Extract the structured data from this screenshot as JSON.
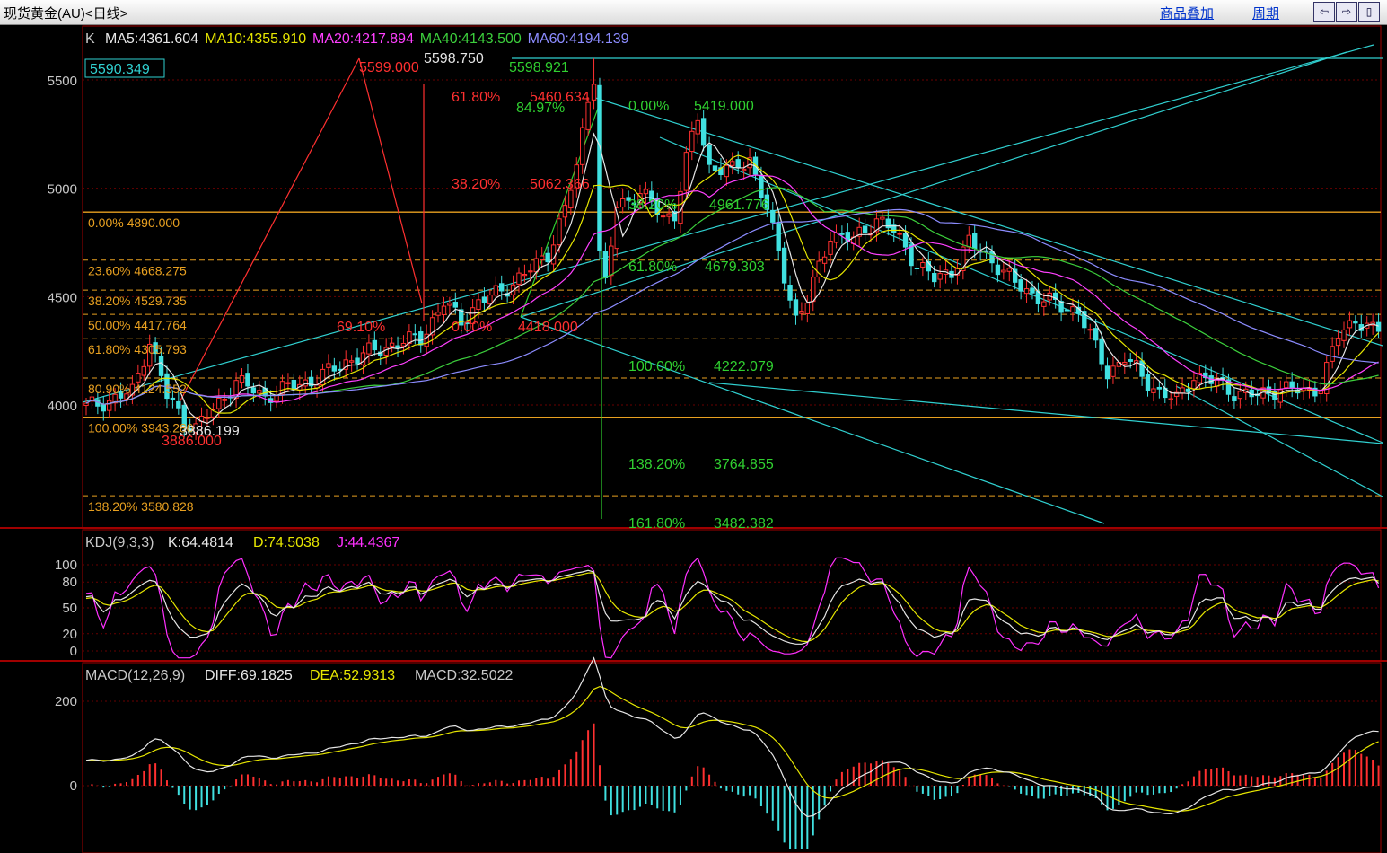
{
  "window": {
    "title": "现货黄金(AU)<日线>",
    "overlay_link": "商品叠加",
    "period_link": "周期"
  },
  "price_panel": {
    "header": {
      "label": "K",
      "ma": [
        {
          "text": "MA5:4361.604",
          "color": "#e6e6e6"
        },
        {
          "text": "MA10:4355.910",
          "color": "#e6e600"
        },
        {
          "text": "MA20:4217.894",
          "color": "#ff40ff"
        },
        {
          "text": "MA40:4143.500",
          "color": "#3ccf3c"
        },
        {
          "text": "MA60:4194.139",
          "color": "#8c8cff"
        }
      ]
    },
    "price_tag": "5590.349",
    "y_ticks": [
      "5500",
      "5000",
      "4500",
      "4000"
    ],
    "left_fib": [
      {
        "text": "0.00% 4890.000",
        "value": 4890.0
      },
      {
        "text": "23.60% 4668.275",
        "value": 4668.275
      },
      {
        "text": "38.20% 4529.735",
        "value": 4529.735
      },
      {
        "text": "50.00% 4417.764",
        "value": 4417.764
      },
      {
        "text": "61.80% 4305.793",
        "value": 4305.793
      },
      {
        "text": "80.90% 4124.552",
        "value": 4124.552
      },
      {
        "text": "100.00% 3943.280",
        "value": 3943.28
      },
      {
        "text": "138.20% 3580.828",
        "value": 3580.828
      }
    ],
    "green_fib": [
      {
        "pct": "0.00%",
        "value": "5419.000"
      },
      {
        "pct": "38.20%",
        "value": "4961.776"
      },
      {
        "pct": "61.80%",
        "value": "4679.303"
      },
      {
        "pct": "100.00%",
        "value": "4222.079"
      },
      {
        "pct": "138.20%",
        "value": "3764.855"
      },
      {
        "pct": "161.80%",
        "value": "3482.382"
      },
      {
        "pct": "84.97%",
        "value": ""
      }
    ],
    "red_fib": [
      {
        "pct": "61.80%",
        "value": "5460.634"
      },
      {
        "pct": "38.20%",
        "value": "5062.366"
      },
      {
        "pct": "0.00%",
        "value": "4418.000"
      },
      {
        "pct": "69.10%",
        "value": ""
      }
    ],
    "extreme_labels": [
      "5599.000",
      "5598.750",
      "5598.921",
      "3886.199",
      "3886.000"
    ]
  },
  "kdj_panel": {
    "label": "KDJ(9,3,3)",
    "k": "K:64.4814",
    "d": "D:74.5038",
    "j": "J:44.4367",
    "y_ticks": [
      "100",
      "80",
      "50",
      "20",
      "0"
    ]
  },
  "macd_panel": {
    "label": "MACD(12,26,9)",
    "diff": "DIFF:69.1825",
    "dea": "DEA:52.9313",
    "macd": "MACD:32.5022",
    "y_ticks": [
      "200",
      "0"
    ]
  },
  "chart_data": {
    "type": "candlestick",
    "symbol": "AU",
    "interval": "daily",
    "price_ylim": [
      3560,
      5700
    ],
    "kdj_ylim": [
      -10,
      110
    ],
    "macd_ylim": [
      -160,
      245
    ],
    "anchors": [
      [
        0,
        3990
      ],
      [
        5,
        4030
      ],
      [
        8,
        4060
      ],
      [
        11,
        4300
      ],
      [
        14,
        4040
      ],
      [
        17,
        3930
      ],
      [
        19,
        3895
      ],
      [
        22,
        3975
      ],
      [
        26,
        4110
      ],
      [
        31,
        4040
      ],
      [
        36,
        4090
      ],
      [
        40,
        4120
      ],
      [
        45,
        4200
      ],
      [
        52,
        4270
      ],
      [
        58,
        4310
      ],
      [
        62,
        4470
      ],
      [
        65,
        4390
      ],
      [
        68,
        4470
      ],
      [
        72,
        4530
      ],
      [
        76,
        4600
      ],
      [
        80,
        4700
      ],
      [
        83,
        4900
      ],
      [
        85,
        5100
      ],
      [
        87,
        5420
      ],
      [
        88,
        5520
      ],
      [
        89,
        4700
      ],
      [
        90,
        4550
      ],
      [
        92,
        4920
      ],
      [
        96,
        4980
      ],
      [
        100,
        4870
      ],
      [
        102,
        4880
      ],
      [
        104,
        5130
      ],
      [
        106,
        5330
      ],
      [
        108,
        5100
      ],
      [
        112,
        5080
      ],
      [
        115,
        5140
      ],
      [
        118,
        4900
      ],
      [
        121,
        4600
      ],
      [
        123,
        4400
      ],
      [
        125,
        4480
      ],
      [
        129,
        4790
      ],
      [
        133,
        4760
      ],
      [
        137,
        4860
      ],
      [
        140,
        4800
      ],
      [
        144,
        4650
      ],
      [
        147,
        4580
      ],
      [
        150,
        4620
      ],
      [
        153,
        4750
      ],
      [
        157,
        4670
      ],
      [
        161,
        4560
      ],
      [
        165,
        4500
      ],
      [
        169,
        4450
      ],
      [
        172,
        4440
      ],
      [
        175,
        4260
      ],
      [
        177,
        4150
      ],
      [
        180,
        4220
      ],
      [
        183,
        4130
      ],
      [
        186,
        4060
      ],
      [
        189,
        4020
      ],
      [
        192,
        4140
      ],
      [
        195,
        4110
      ],
      [
        199,
        4060
      ],
      [
        203,
        4040
      ],
      [
        207,
        4080
      ],
      [
        211,
        4060
      ],
      [
        214,
        4090
      ],
      [
        217,
        4320
      ],
      [
        220,
        4400
      ],
      [
        223,
        4340
      ]
    ]
  }
}
